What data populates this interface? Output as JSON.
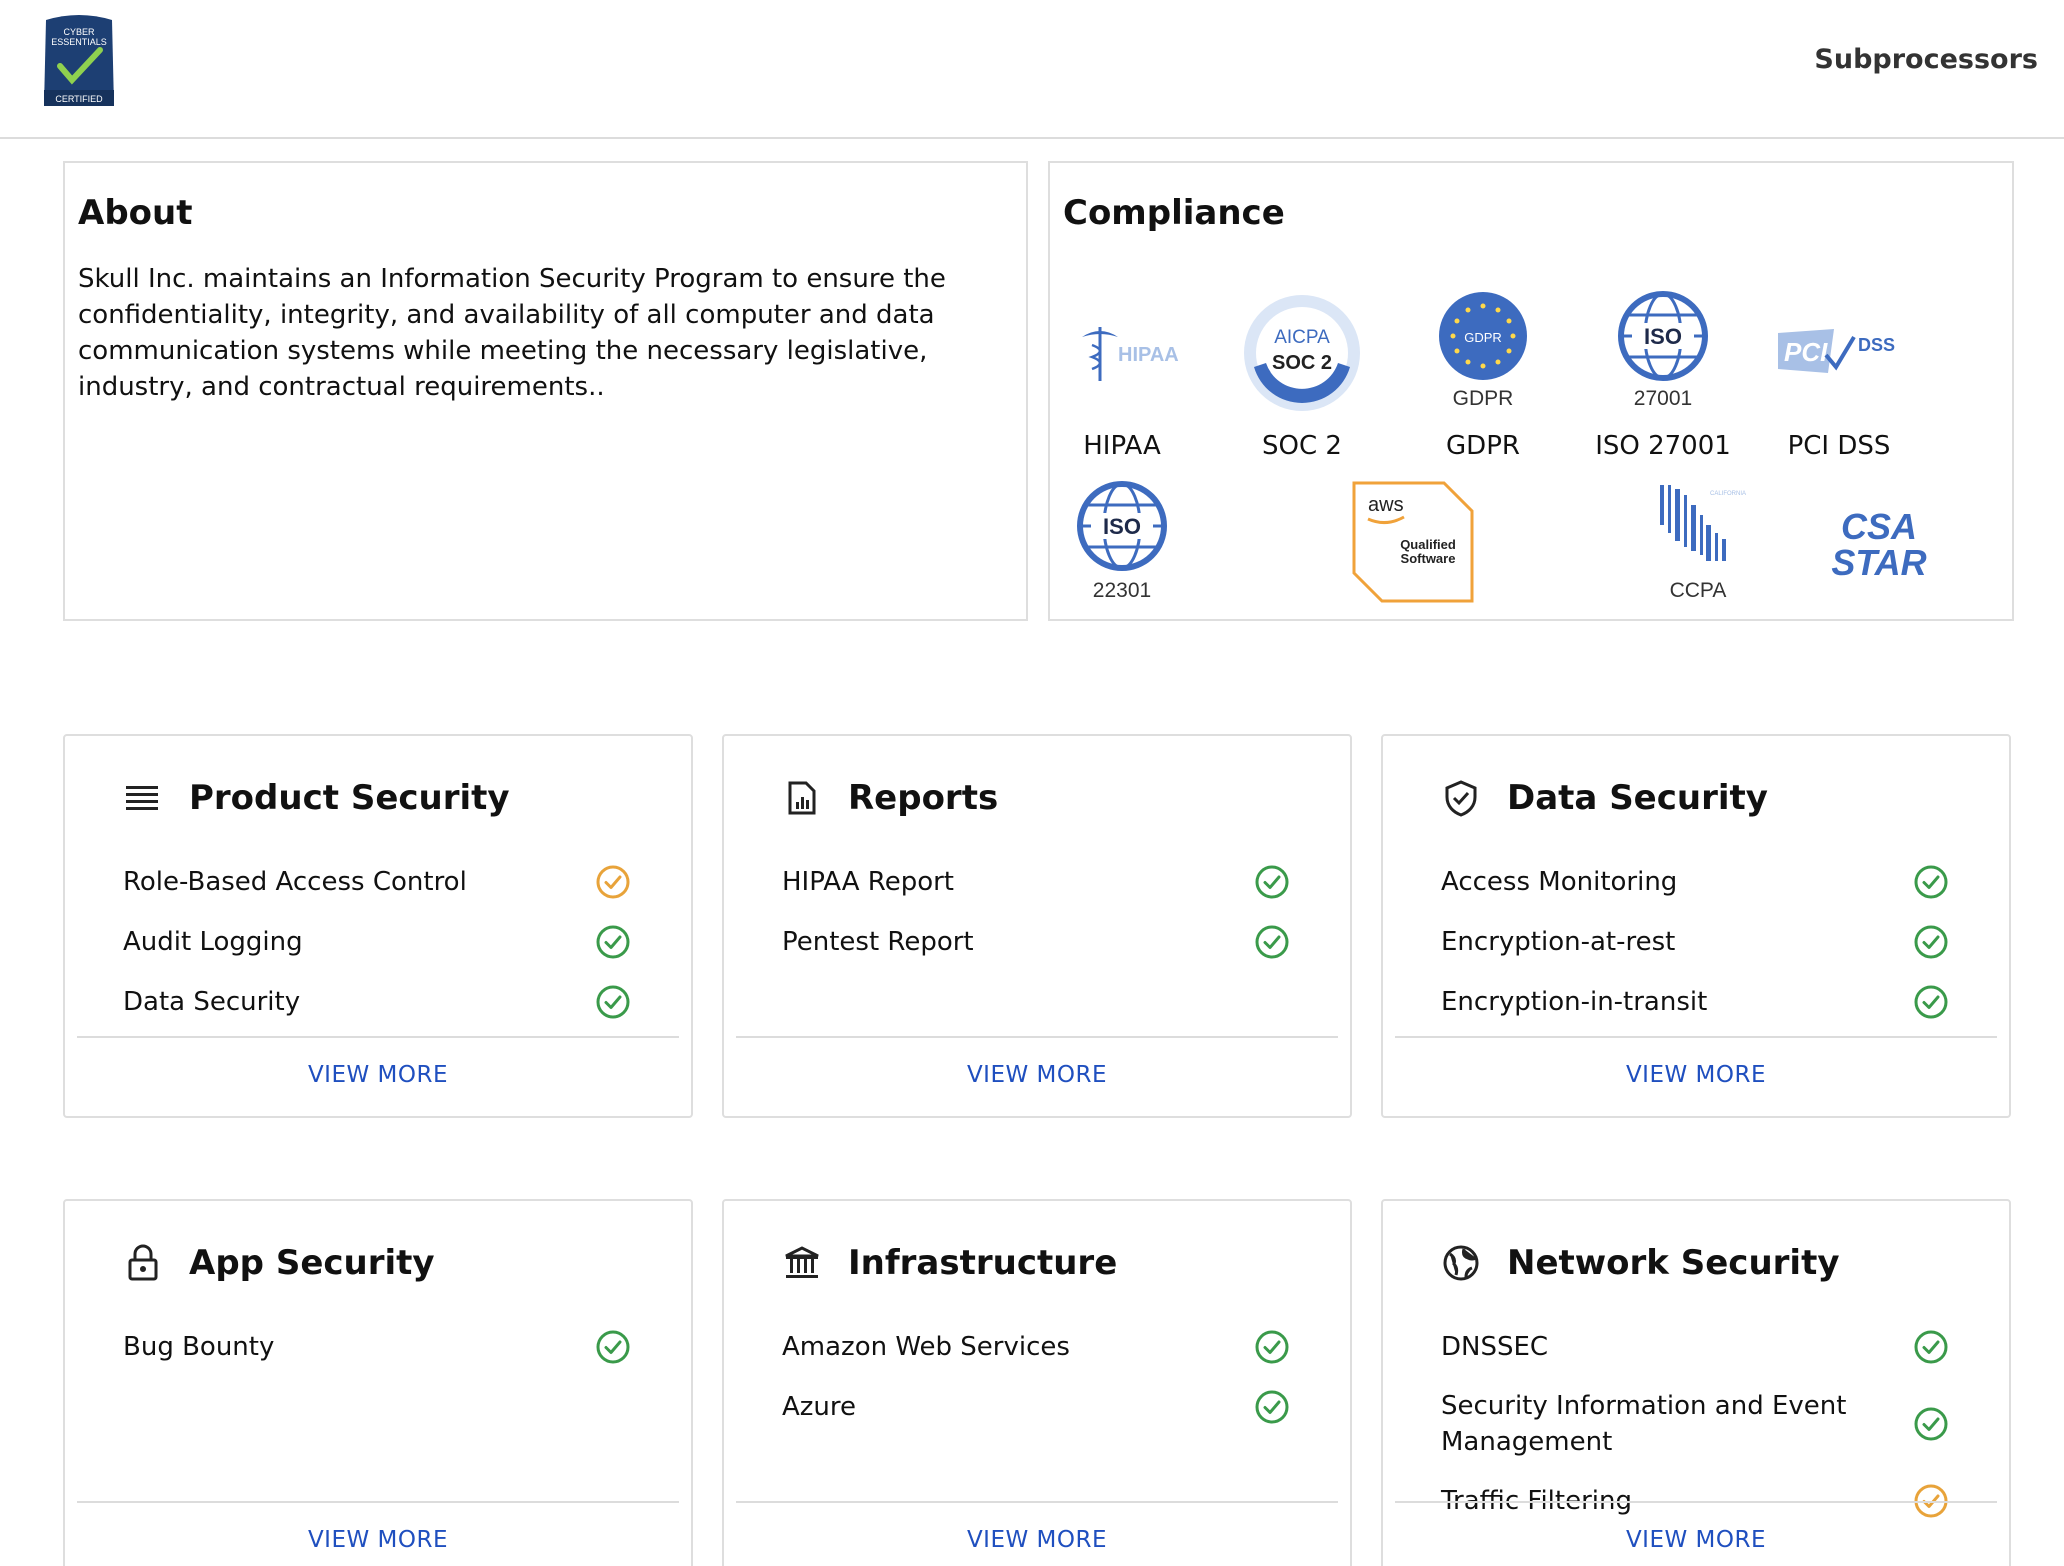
{
  "header": {
    "logo_text": {
      "line1": "CYBER",
      "line2": "ESSENTIALS",
      "line3": "CERTIFIED"
    },
    "nav_link": "Subprocessors"
  },
  "about": {
    "title": "About",
    "text": "Skull Inc. maintains an Information Security Program to ensure the confidentiality, integrity, and availability of all computer and data communication systems while meeting the necessary legislative, industry, and contractual requirements.."
  },
  "compliance": {
    "title": "Compliance",
    "badges": [
      {
        "icon": "hipaa-logo",
        "logo_text": "HIPAA",
        "label": "HIPAA"
      },
      {
        "icon": "soc2-logo",
        "logo_text": "AICPA",
        "logo_sub": "SOC 2",
        "label": "SOC 2"
      },
      {
        "icon": "gdpr-logo",
        "logo_text": "GDPR",
        "caption": "GDPR",
        "label": "GDPR"
      },
      {
        "icon": "iso-globe-logo",
        "logo_text": "ISO",
        "caption": "27001",
        "label": "ISO 27001"
      },
      {
        "icon": "pci-dss-logo",
        "logo_text": "PCI",
        "logo_sub": "DSS",
        "label": "PCI DSS"
      },
      {
        "icon": "iso-globe-logo",
        "logo_text": "ISO",
        "caption": "22301"
      },
      {
        "icon": "aws-qualified-logo",
        "logo_text": "aws",
        "logo_sub1": "Qualified",
        "logo_sub2": "Software"
      },
      {
        "icon": "ccpa-logo",
        "caption": "CCPA"
      },
      {
        "icon": "csa-star-logo",
        "logo_text": "CSA",
        "logo_sub": "STAR"
      }
    ]
  },
  "colors": {
    "ok": "#3a9a4a",
    "pending": "#e8a33a",
    "link": "#1f4fbf",
    "badge_blue": "#3d6bbf"
  },
  "cards": [
    {
      "title": "Product Security",
      "icon": "list-icon",
      "items": [
        {
          "label": "Role-Based Access Control",
          "status": "pending"
        },
        {
          "label": "Audit Logging",
          "status": "ok"
        },
        {
          "label": "Data Security",
          "status": "ok"
        }
      ],
      "view_more": "VIEW MORE"
    },
    {
      "title": "Reports",
      "icon": "report-icon",
      "items": [
        {
          "label": "HIPAA Report",
          "status": "ok"
        },
        {
          "label": "Pentest Report",
          "status": "ok"
        }
      ],
      "view_more": "VIEW MORE"
    },
    {
      "title": "Data Security",
      "icon": "shield-icon",
      "items": [
        {
          "label": "Access Monitoring",
          "status": "ok"
        },
        {
          "label": "Encryption-at-rest",
          "status": "ok"
        },
        {
          "label": "Encryption-in-transit",
          "status": "ok"
        }
      ],
      "view_more": "VIEW MORE"
    },
    {
      "title": "App Security",
      "icon": "lock-icon",
      "items": [
        {
          "label": "Bug Bounty",
          "status": "ok"
        }
      ],
      "view_more": "VIEW MORE"
    },
    {
      "title": "Infrastructure",
      "icon": "bank-icon",
      "items": [
        {
          "label": "Amazon Web Services",
          "status": "ok"
        },
        {
          "label": "Azure",
          "status": "ok"
        }
      ],
      "view_more": "VIEW MORE"
    },
    {
      "title": "Network Security",
      "icon": "globe-icon",
      "items": [
        {
          "label": "DNSSEC",
          "status": "ok"
        },
        {
          "label": "Security Information and Event Management",
          "status": "ok"
        },
        {
          "label": "Traffic Filtering",
          "status": "pending"
        }
      ],
      "view_more": "VIEW MORE"
    }
  ]
}
